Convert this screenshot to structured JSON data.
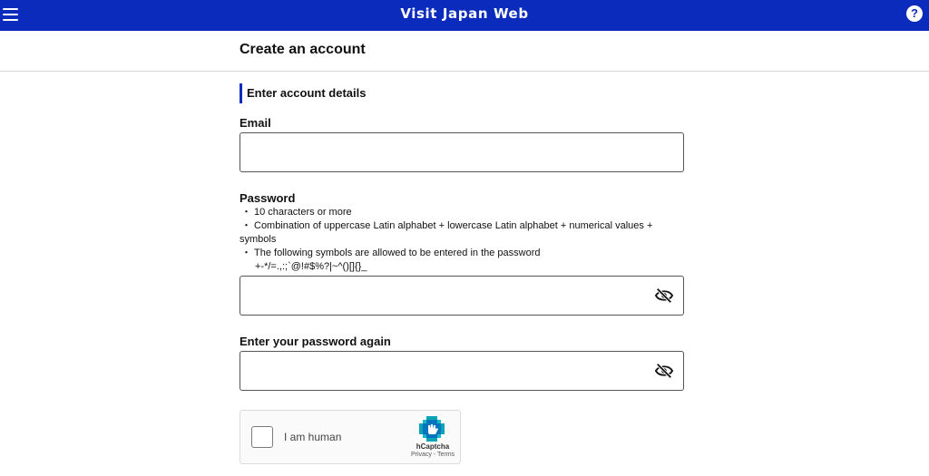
{
  "header": {
    "title": "Visit Japan Web",
    "menu_icon": "hamburger-menu-icon",
    "help_icon": "question-mark-icon",
    "help_glyph": "?",
    "background_color": "#0a2bbb"
  },
  "page": {
    "title": "Create an account"
  },
  "section": {
    "title": "Enter account details",
    "accent_color": "#0a2bbb"
  },
  "email": {
    "label": "Email",
    "value": ""
  },
  "password": {
    "label": "Password",
    "value": "",
    "toggle_icon": "eye-slash-icon",
    "rules": {
      "bullet": "・",
      "length": "10 characters or more",
      "combination": "Combination of uppercase Latin alphabet + lowercase Latin alphabet + numerical values + symbols",
      "symbols_intro": "The following symbols are allowed to be entered in the password",
      "symbols": "+-*/=.,:;`@!#$%?|~^()[]{}_"
    }
  },
  "confirm_password": {
    "label": "Enter your password again",
    "value": "",
    "toggle_icon": "eye-slash-icon"
  },
  "captcha": {
    "checkbox_label": "I am human",
    "brand": "hCaptcha",
    "privacy_link": "Privacy",
    "separator": " - ",
    "terms_link": "Terms",
    "logo_icon": "hcaptcha-logo-icon"
  }
}
